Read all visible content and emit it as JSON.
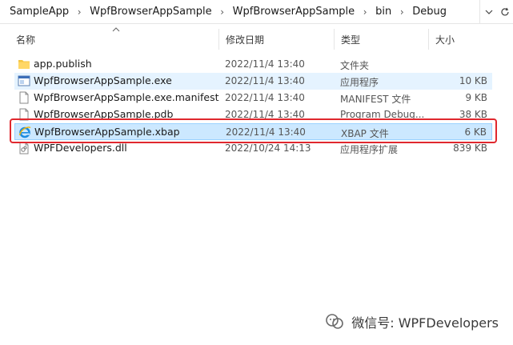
{
  "breadcrumb": {
    "items": [
      "SampleApp",
      "WpfBrowserAppSample",
      "WpfBrowserAppSample",
      "bin",
      "Debug"
    ]
  },
  "columns": {
    "name": "名称",
    "date": "修改日期",
    "type": "类型",
    "size": "大小"
  },
  "files": [
    {
      "name": "app.publish",
      "date": "2022/11/4 13:40",
      "type": "文件夹",
      "size": "",
      "icon": "folder-icon",
      "state": "normal"
    },
    {
      "name": "WpfBrowserAppSample.exe",
      "date": "2022/11/4 13:40",
      "type": "应用程序",
      "size": "10 KB",
      "icon": "exe-icon",
      "state": "hover"
    },
    {
      "name": "WpfBrowserAppSample.exe.manifest",
      "date": "2022/11/4 13:40",
      "type": "MANIFEST 文件",
      "size": "9 KB",
      "icon": "file-icon",
      "state": "normal"
    },
    {
      "name": "WpfBrowserAppSample.pdb",
      "date": "2022/11/4 13:40",
      "type": "Program Debug...",
      "size": "38 KB",
      "icon": "file-icon",
      "state": "normal"
    },
    {
      "name": "WpfBrowserAppSample.xbap",
      "date": "2022/11/4 13:40",
      "type": "XBAP 文件",
      "size": "6 KB",
      "icon": "ie-icon",
      "state": "selected"
    },
    {
      "name": "WPFDevelopers.dll",
      "date": "2022/10/24 14:13",
      "type": "应用程序扩展",
      "size": "839 KB",
      "icon": "dll-icon",
      "state": "normal"
    }
  ],
  "watermark": {
    "text": "微信号: WPFDevelopers"
  },
  "colors": {
    "highlight": "#e0282e",
    "selected_bg": "#cce8ff",
    "hover_bg": "#e5f3ff",
    "folder": "#f5c542"
  }
}
